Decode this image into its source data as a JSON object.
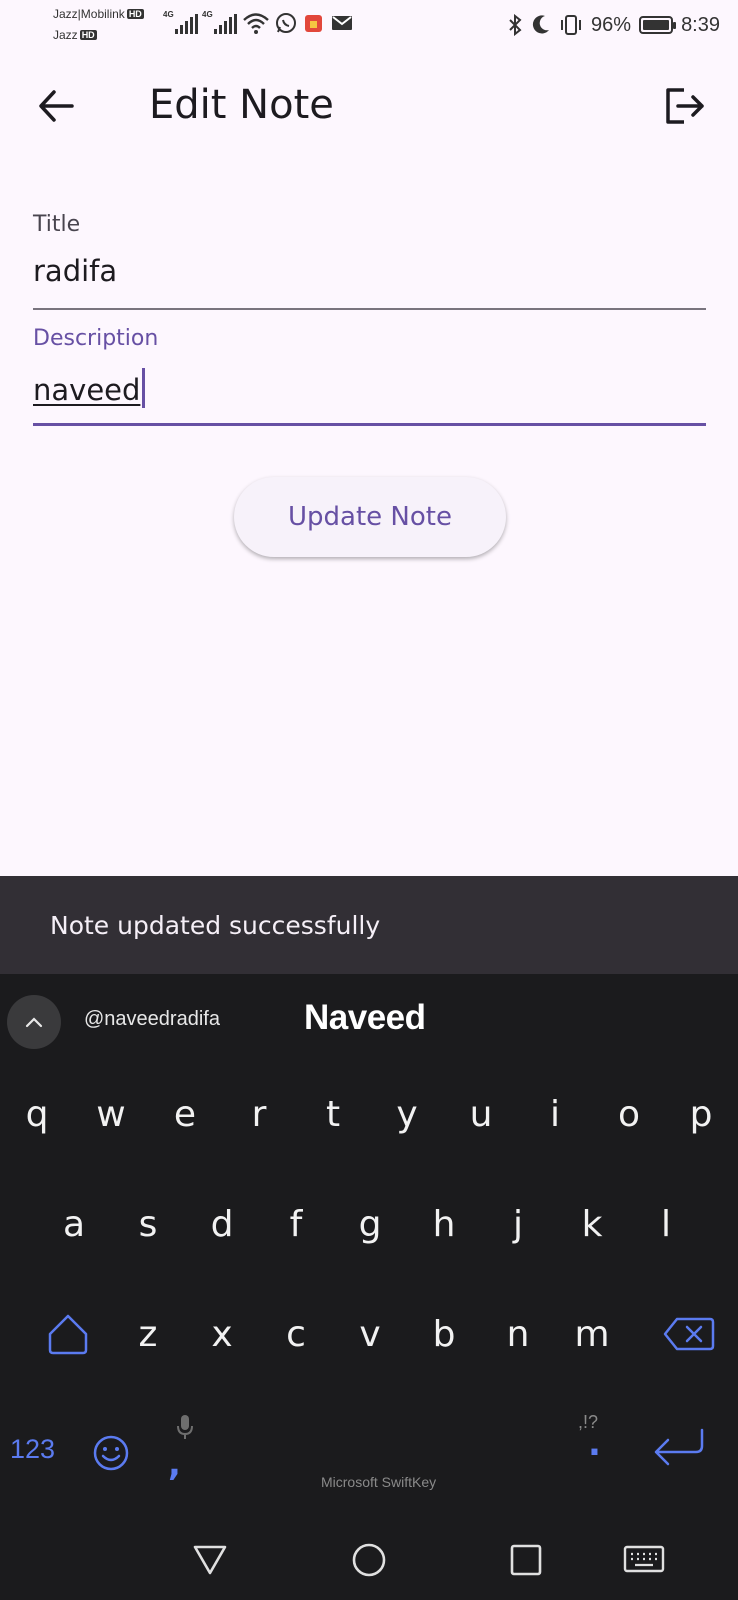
{
  "status_bar": {
    "carrier_1": "Jazz|Mobilink",
    "carrier_2": "Jazz",
    "hd_badge": "HD",
    "network_tag": "4G",
    "battery": "96%",
    "time": "8:39"
  },
  "app_bar": {
    "title": "Edit Note",
    "back_icon": "arrow-back-icon",
    "logout_icon": "logout-icon"
  },
  "form": {
    "title_label": "Title",
    "title_value": "radifa",
    "description_label": "Description",
    "description_value": "naveed",
    "submit_label": "Update Note"
  },
  "snackbar": {
    "message": "Note updated successfully"
  },
  "keyboard": {
    "suggestions": [
      "@naveedradifa",
      "Naveed"
    ],
    "row1": [
      "q",
      "w",
      "e",
      "r",
      "t",
      "y",
      "u",
      "i",
      "o",
      "p"
    ],
    "row2": [
      "a",
      "s",
      "d",
      "f",
      "g",
      "h",
      "j",
      "k",
      "l"
    ],
    "row3": [
      "z",
      "x",
      "c",
      "v",
      "b",
      "n",
      "m"
    ],
    "numbers_label": "123",
    "comma": ",",
    "period": ".",
    "punct_hint": ",!?",
    "brand": "Microsoft SwiftKey"
  },
  "colors": {
    "accent": "#6750a4",
    "keyboard_accent": "#5b7bf0",
    "background": "#fdf7fe",
    "snackbar": "#322f35",
    "keyboard": "#1b1b1d"
  }
}
